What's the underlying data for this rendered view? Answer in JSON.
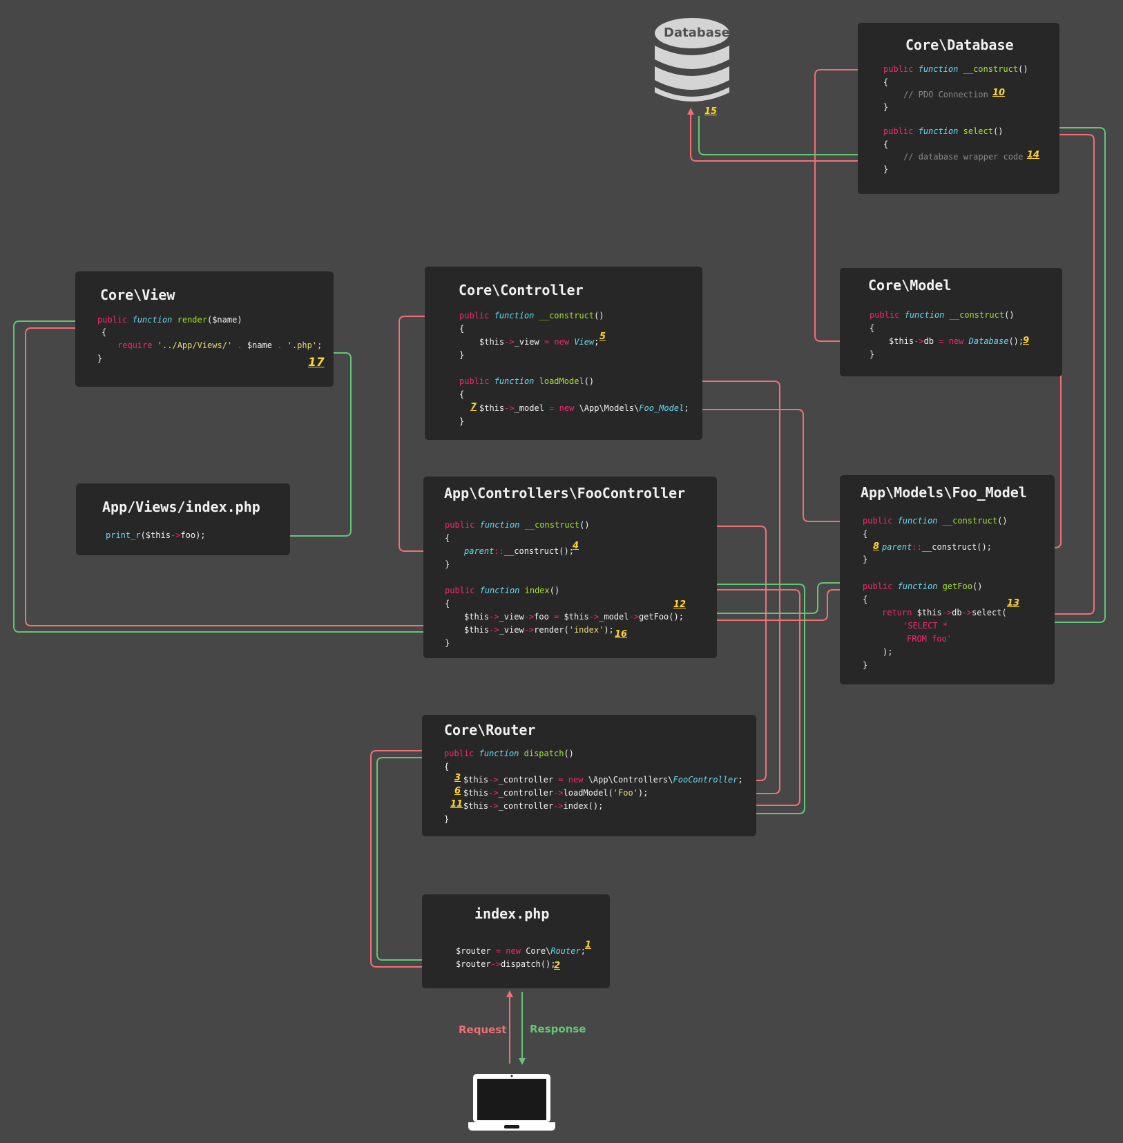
{
  "database": {
    "label": "Database",
    "step": "15"
  },
  "core_database": {
    "title": "Core\\Database",
    "construct": [
      "public",
      "function",
      "__construct",
      "()"
    ],
    "comment_pdo": "// PDO Connection",
    "step_10": "10",
    "select": [
      "public",
      "function",
      "select",
      "()"
    ],
    "comment_wrapper": "// database wrapper code",
    "step_14": "14"
  },
  "core_view": {
    "title": "Core\\View",
    "render": [
      "public",
      "function",
      "render",
      "($name)"
    ],
    "require": [
      "require",
      "'../App/Views/'",
      ".",
      "$name",
      ".",
      "'.php';"
    ],
    "step_17": "17"
  },
  "core_controller": {
    "title": "Core\\Controller",
    "construct": [
      "public",
      "function",
      "__construct",
      "()"
    ],
    "view_line": [
      "$this",
      "->",
      "_view",
      "=",
      "new",
      "View",
      ";"
    ],
    "step_5": "5",
    "load_model": [
      "public",
      "function",
      "loadModel",
      "()"
    ],
    "model_line": [
      "$this",
      "->",
      "_model",
      "=",
      "new",
      "\\App\\Models\\",
      "Foo_Model",
      ";"
    ],
    "step_7": "7"
  },
  "core_model": {
    "title": "Core\\Model",
    "construct": [
      "public",
      "function",
      "__construct",
      "()"
    ],
    "db_line": [
      "$this",
      "->",
      "db",
      "=",
      "new",
      "Database",
      "();"
    ],
    "step_9": "9"
  },
  "views_index": {
    "title": "App/Views/index.php",
    "line": [
      "print_r",
      "($this",
      "->",
      "foo);"
    ]
  },
  "foo_controller": {
    "title": "App\\Controllers\\FooController",
    "construct": [
      "public",
      "function",
      "__construct",
      "()"
    ],
    "parent_line": [
      "parent",
      "::",
      "__construct();"
    ],
    "step_4": "4",
    "index": [
      "public",
      "function",
      "index",
      "()"
    ],
    "foo_line": [
      "$this",
      "->",
      "_view",
      "->",
      "foo",
      "=",
      "$this",
      "->",
      "_model",
      "->",
      "getFoo();"
    ],
    "step_12": "12",
    "render_line": [
      "$this",
      "->",
      "_view",
      "->",
      "render(",
      "'index'",
      ");"
    ],
    "step_16": "16"
  },
  "foo_model": {
    "title": "App\\Models\\Foo_Model",
    "construct": [
      "public",
      "function",
      "__construct",
      "()"
    ],
    "parent_line": [
      "parent",
      "::",
      "__construct();"
    ],
    "step_8": "8",
    "getfoo": [
      "public",
      "function",
      "getFoo",
      "()"
    ],
    "return_line": [
      "return",
      "$this",
      "->",
      "db",
      "->",
      "select("
    ],
    "sql_1": "'SELECT *",
    "sql_2": "FROM foo'",
    "close": ");",
    "step_13": "13"
  },
  "core_router": {
    "title": "Core\\Router",
    "dispatch": [
      "public",
      "function",
      "dispatch",
      "()"
    ],
    "ctrl_line": [
      "$this",
      "->",
      "_controller",
      "=",
      "new",
      "\\App\\Controllers\\",
      "FooController",
      ";"
    ],
    "step_3": "3",
    "load_line": [
      "$this",
      "->",
      "_controller",
      "->",
      "loadModel(",
      "'Foo'",
      ");"
    ],
    "step_6": "6",
    "index_line": [
      "$this",
      "->",
      "_controller",
      "->",
      "index();"
    ],
    "step_11": "11"
  },
  "index_php": {
    "title": "index.php",
    "router_line": [
      "$router",
      "=",
      "new",
      "Core\\",
      "Router",
      ";"
    ],
    "step_1": "1",
    "dispatch_line": [
      "$router",
      "->",
      "dispatch();"
    ],
    "step_2": "2"
  },
  "labels": {
    "request": "Request",
    "response": "Response"
  },
  "braces": {
    "open": "{",
    "close": "}"
  },
  "colors": {
    "background": "#474747",
    "box": "#272727",
    "request": "#f07077",
    "response": "#62c774",
    "step": "#ffd52b"
  },
  "icons": {
    "database": "database-icon",
    "client": "laptop-icon"
  }
}
